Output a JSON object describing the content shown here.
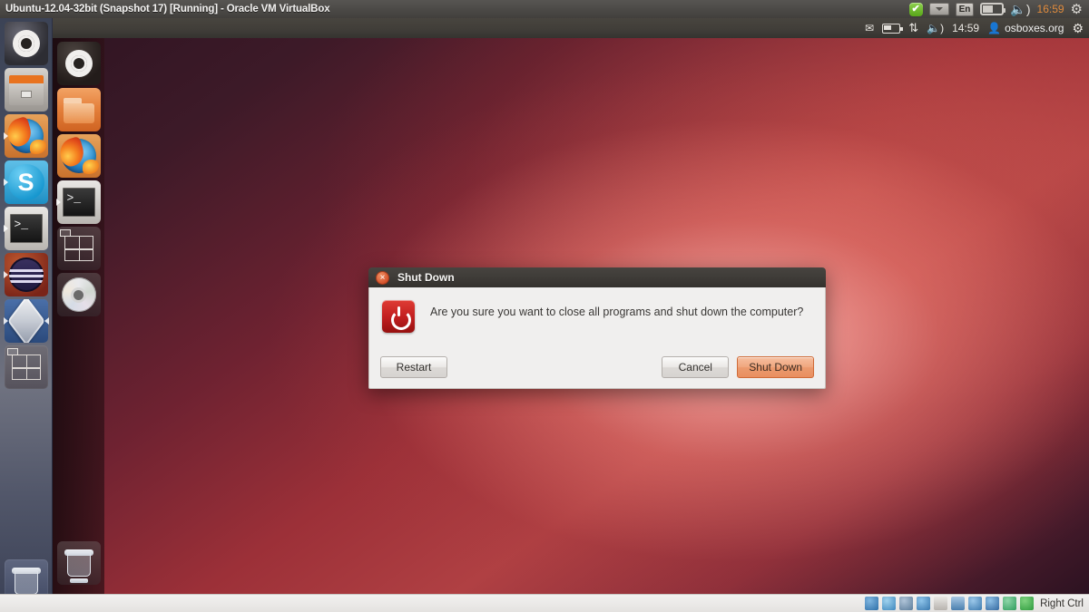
{
  "vbox_window": {
    "title": "Ubuntu-12.04-32bit (Snapshot 17) [Running] - Oracle VM VirtualBox",
    "host_indicators": [
      {
        "name": "checkmark-badge-icon",
        "label": "✔"
      },
      {
        "name": "dropdown-chip-icon",
        "label": ""
      },
      {
        "name": "keyboard-layout-indicator",
        "label": "En"
      },
      {
        "name": "battery-icon",
        "label": ""
      },
      {
        "name": "volume-icon",
        "label": "🔊"
      },
      {
        "name": "clock",
        "label": "16:59"
      },
      {
        "name": "power-gear-icon",
        "label": "⚙"
      }
    ],
    "host_clock": "16:59",
    "host_keyboard": "En",
    "host_volume_glyph": "◀))"
  },
  "host_launcher": {
    "items": [
      {
        "name": "dash-home",
        "label": "Dash Home",
        "art": "art-ubuntu",
        "running": false
      },
      {
        "name": "files",
        "label": "Files",
        "art": "art-files-host",
        "running": false
      },
      {
        "name": "firefox",
        "label": "Firefox Web Browser",
        "art": "art-firefox",
        "running": true
      },
      {
        "name": "skype",
        "label": "Skype",
        "art": "art-skype",
        "running": true,
        "glyph": "S"
      },
      {
        "name": "terminal",
        "label": "Terminal",
        "art": "art-term",
        "running": true,
        "glyph": ">_"
      },
      {
        "name": "disk-utility",
        "label": "Disk",
        "art": "art-disk",
        "running": true
      },
      {
        "name": "virtualbox",
        "label": "Oracle VM VirtualBox",
        "art": "art-vbox",
        "running": true
      },
      {
        "name": "workspace-switcher",
        "label": "Workspace Switcher",
        "art": "art-wsw",
        "running": false
      }
    ],
    "trash_label": "Trash"
  },
  "vm": {
    "panel": {
      "indicators": [
        {
          "name": "messaging-envelope-icon",
          "label": "✉"
        },
        {
          "name": "battery-icon",
          "label": ""
        },
        {
          "name": "network-icon",
          "label": "↑↓"
        },
        {
          "name": "volume-icon",
          "label": "🔊"
        }
      ],
      "clock": "14:59",
      "user": "osboxes.org",
      "user_icon": "user-avatar-icon",
      "session_icon": "session-gear-icon",
      "session_glyph": "⚙"
    },
    "launcher": {
      "items": [
        {
          "name": "dash-home",
          "label": "Dash Home",
          "art": "art-ubuntu-dark",
          "running": false
        },
        {
          "name": "files",
          "label": "Home Folder",
          "art": "art-folder-vm",
          "running": false
        },
        {
          "name": "firefox",
          "label": "Firefox Web Browser",
          "art": "art-firefox",
          "running": false
        },
        {
          "name": "terminal",
          "label": "Terminal",
          "art": "art-term",
          "running": true,
          "glyph": ">_"
        },
        {
          "name": "workspace-switcher",
          "label": "Workspace Switcher",
          "art": "art-wsw",
          "running": false
        },
        {
          "name": "cd-drive",
          "label": "CD/DVD Drive",
          "art": "art-cd",
          "running": false
        }
      ],
      "trash_label": "Trash"
    }
  },
  "dialog": {
    "title": "Shut Down",
    "close_label": "×",
    "icon": "power-button-icon",
    "message": "Are you sure you want to close all programs and shut down the computer?",
    "buttons": {
      "restart": "Restart",
      "cancel": "Cancel",
      "shutdown": "Shut Down"
    },
    "accent_color": "#eb9a6e"
  },
  "status_bar": {
    "icons": [
      {
        "name": "hard-disk-icon",
        "cls": "sb-1"
      },
      {
        "name": "optical-disc-icon",
        "cls": "sb-2"
      },
      {
        "name": "floppy-icon",
        "cls": "sb-3"
      },
      {
        "name": "usb-icon",
        "cls": "sb-4"
      },
      {
        "name": "shared-folder-icon",
        "cls": "sb-5"
      },
      {
        "name": "display-icon",
        "cls": "sb-6"
      },
      {
        "name": "network-icon",
        "cls": "sb-7"
      },
      {
        "name": "video-capture-icon",
        "cls": "sb-8"
      },
      {
        "name": "shared-clipboard-icon",
        "cls": "sb-9"
      },
      {
        "name": "guest-additions-icon",
        "cls": "sb-10"
      }
    ],
    "host_key": "Right Ctrl"
  }
}
